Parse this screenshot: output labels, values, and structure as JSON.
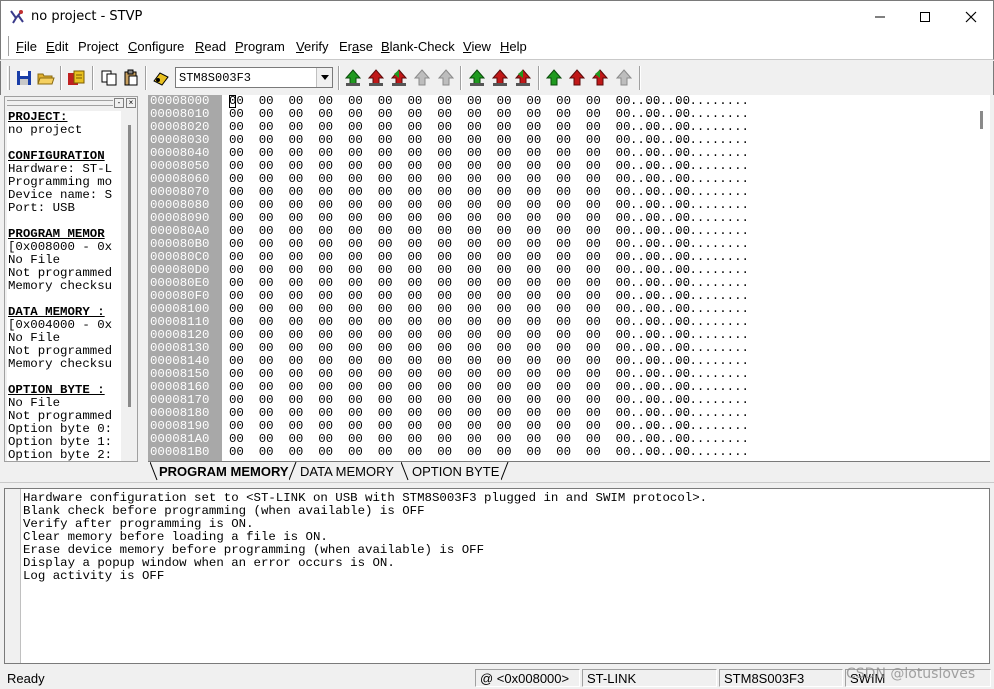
{
  "window": {
    "title": "no project - STVP",
    "app_icon": "stvp-logo-icon",
    "minimize_icon": "minimize-icon",
    "maximize_icon": "maximize-icon",
    "close_icon": "close-icon"
  },
  "menu": [
    {
      "label": "File",
      "mnemonic": "F"
    },
    {
      "label": "Edit",
      "mnemonic": "E"
    },
    {
      "label": "Project",
      "mnemonic": "j"
    },
    {
      "label": "Configure",
      "mnemonic": "C"
    },
    {
      "label": "Read",
      "mnemonic": "R"
    },
    {
      "label": "Program",
      "mnemonic": "P"
    },
    {
      "label": "Verify",
      "mnemonic": "V"
    },
    {
      "label": "Erase",
      "mnemonic": "a"
    },
    {
      "label": "Blank-Check",
      "mnemonic": "B"
    },
    {
      "label": "View",
      "mnemonic": "V"
    },
    {
      "label": "Help",
      "mnemonic": "H"
    }
  ],
  "toolbar": {
    "device": "STM8S003F3",
    "buttons": [
      "save-icon",
      "open-icon",
      "program-project-icon",
      "copy-icon",
      "paste-icon",
      "device-icon",
      "read-all-icon",
      "program-all-icon",
      "verify-all-icon",
      "erase-all-icon",
      "blank-check-all-icon",
      "read-current-icon",
      "program-current-icon",
      "verify-current-icon",
      "read-tab-icon",
      "program-tab-icon",
      "verify-tab-icon",
      "blank-check-tab-icon"
    ],
    "colors": {
      "green": "#1f9a1f",
      "red": "#c01818",
      "gray": "#a0a0a0"
    }
  },
  "info_panel": {
    "lines": [
      {
        "text": "PROJECT:",
        "heading": true
      },
      {
        "text": "no project",
        "heading": false
      },
      {
        "text": "",
        "heading": false
      },
      {
        "text": "CONFIGURATION",
        "heading": true
      },
      {
        "text": "Hardware: ST-L",
        "heading": false
      },
      {
        "text": "Programming mo",
        "heading": false
      },
      {
        "text": "Device name: S",
        "heading": false
      },
      {
        "text": "Port: USB",
        "heading": false
      },
      {
        "text": "",
        "heading": false
      },
      {
        "text": "PROGRAM MEMOR",
        "heading": true
      },
      {
        "text": "[0x008000 - 0x",
        "heading": false
      },
      {
        "text": "No File",
        "heading": false
      },
      {
        "text": "Not programmed",
        "heading": false
      },
      {
        "text": "Memory checksu",
        "heading": false
      },
      {
        "text": "",
        "heading": false
      },
      {
        "text": "DATA MEMORY :",
        "heading": true
      },
      {
        "text": "[0x004000 - 0x",
        "heading": false
      },
      {
        "text": "No File",
        "heading": false
      },
      {
        "text": "Not programmed",
        "heading": false
      },
      {
        "text": "Memory checksu",
        "heading": false
      },
      {
        "text": "",
        "heading": false
      },
      {
        "text": "OPTION BYTE :",
        "heading": true
      },
      {
        "text": "No File",
        "heading": false
      },
      {
        "text": "Not programmed",
        "heading": false
      },
      {
        "text": "Option byte 0:",
        "heading": false
      },
      {
        "text": "Option byte 1:",
        "heading": false
      },
      {
        "text": "Option byte 2:",
        "heading": false
      }
    ]
  },
  "hex": {
    "addresses": [
      "00008000",
      "00008010",
      "00008020",
      "00008030",
      "00008040",
      "00008050",
      "00008060",
      "00008070",
      "00008080",
      "00008090",
      "000080A0",
      "000080B0",
      "000080C0",
      "000080D0",
      "000080E0",
      "000080F0",
      "00008100",
      "00008110",
      "00008120",
      "00008130",
      "00008140",
      "00008150",
      "00008160",
      "00008170",
      "00008180",
      "00008190",
      "000081A0",
      "000081B0"
    ],
    "bytes": "00 00 00 00 00 00 00 00 00 00 00 00 00 00 00 00",
    "ascii": "................"
  },
  "tabs": [
    "PROGRAM MEMORY",
    "DATA MEMORY",
    "OPTION BYTE"
  ],
  "active_tab": 0,
  "log": [
    "Hardware configuration set to <ST-LINK on USB with STM8S003F3 plugged in and SWIM protocol>.",
    "Blank check before programming (when available) is OFF",
    "Verify after programming is ON.",
    "Clear memory before loading a file is ON.",
    "Erase device memory before programming (when available) is OFF",
    "Display a popup window when an error occurs is ON.",
    "Log activity is OFF"
  ],
  "status": {
    "ready": "Ready",
    "address": "@ <0x008000>",
    "hardware": "ST-LINK",
    "device": "STM8S003F3",
    "protocol": "SWIM"
  },
  "watermark": "CSDN @lotusloves"
}
